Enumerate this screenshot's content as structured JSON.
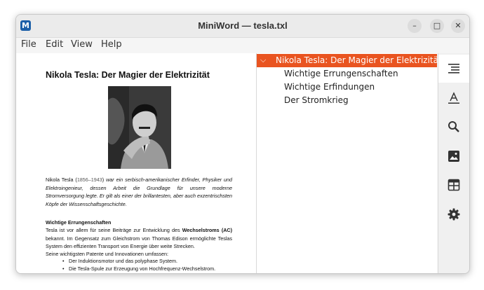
{
  "window": {
    "app_icon_letter": "M",
    "title": "MiniWord — tesla.txl",
    "controls": {
      "minimize": "–",
      "maximize": "□",
      "close": "✕"
    }
  },
  "menu": {
    "file": "File",
    "edit": "Edit",
    "view": "View",
    "help": "Help"
  },
  "document": {
    "title": "Nikola Tesla: Der Magier der Elektrizität",
    "bio": {
      "name": "Nikola Tesla (",
      "years": "1856–1943",
      "close_paren": ")",
      "text": " war ein serbisch-amerikanischer Erfinder, Physiker und Elektroingenieur, dessen Arbeit die Grundlage für unsere moderne Stromversorgung legte. Er gilt als einer der brillantesten, aber auch exzentrischsten Köpfe der Wissenschaftsgeschichte."
    },
    "achievements": {
      "heading": "Wichtige Errungenschaften",
      "text_before": "Tesla ist vor allem für seine Beiträge zur Entwicklung des ",
      "bold": "Wechselstroms (AC)",
      "text_after": " bekannt. Im Gegensatz zum Gleichstrom von Thomas Edison ermöglichte Teslas System den effizienten Transport von Energie über weite Strecken.",
      "list_intro": "Seine wichtigsten Patente und Innovationen umfassen:",
      "bullets": [
        "Der Induktionsmotor und das polyphase System.",
        "Die Tesla-Spule zur Erzeugung von Hochfrequenz-Wechselstrom."
      ]
    }
  },
  "outline": {
    "root": "Nikola Tesla: Der Magier der Elektrizität",
    "items": [
      "Wichtige Errungenschaften",
      "Wichtige Erfindungen",
      "Der Stromkrieg"
    ]
  },
  "sidebar": {
    "buttons": [
      "outline-icon",
      "text-format-icon",
      "search-icon",
      "image-icon",
      "table-icon",
      "gear-icon"
    ],
    "active": "outline-icon"
  },
  "colors": {
    "accent": "#e95420",
    "link": "#1c5fa8"
  }
}
